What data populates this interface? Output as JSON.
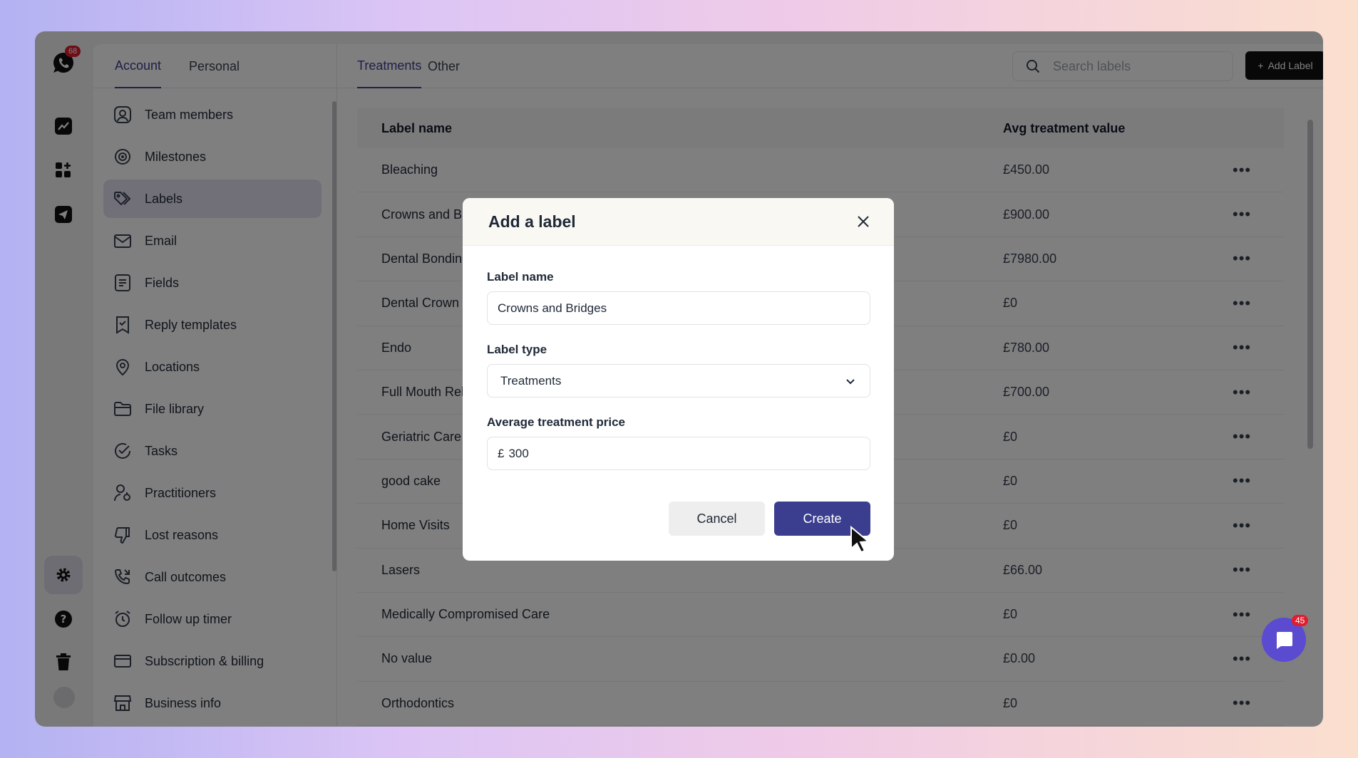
{
  "rail": {
    "logo_badge": "68",
    "icons": [
      "chart-icon",
      "dashboard-icon",
      "send-icon"
    ],
    "bottom_icons": [
      "settings-icon",
      "help-icon",
      "trash-icon",
      "avatar"
    ]
  },
  "settings": {
    "tabs": [
      {
        "label": "Account",
        "active": true
      },
      {
        "label": "Personal",
        "active": false
      }
    ],
    "menu": [
      {
        "label": "Team members",
        "icon": "user-square-icon"
      },
      {
        "label": "Milestones",
        "icon": "target-icon"
      },
      {
        "label": "Labels",
        "icon": "tags-icon",
        "active": true
      },
      {
        "label": "Email",
        "icon": "mail-icon"
      },
      {
        "label": "Fields",
        "icon": "form-icon"
      },
      {
        "label": "Reply templates",
        "icon": "bookmark-icon"
      },
      {
        "label": "Locations",
        "icon": "pin-icon"
      },
      {
        "label": "File library",
        "icon": "folder-icon"
      },
      {
        "label": "Tasks",
        "icon": "check-circle-icon"
      },
      {
        "label": "Practitioners",
        "icon": "practitioner-icon"
      },
      {
        "label": "Lost reasons",
        "icon": "thumbs-down-icon"
      },
      {
        "label": "Call outcomes",
        "icon": "phone-icon"
      },
      {
        "label": "Follow up timer",
        "icon": "alarm-icon"
      },
      {
        "label": "Subscription & billing",
        "icon": "card-icon"
      },
      {
        "label": "Business info",
        "icon": "store-icon"
      }
    ]
  },
  "main": {
    "tabs": [
      {
        "label": "Treatments",
        "active": true
      },
      {
        "label": "Other",
        "active": false
      }
    ],
    "search_placeholder": "Search labels",
    "add_label": "Add Label",
    "columns": [
      "Label name",
      "Avg treatment value"
    ],
    "rows": [
      {
        "name": "Bleaching",
        "value": "£450.00"
      },
      {
        "name": "Crowns and Bridges",
        "value": "£900.00"
      },
      {
        "name": "Dental Bonding",
        "value": "£7980.00"
      },
      {
        "name": "Dental Crown",
        "value": "£0"
      },
      {
        "name": "Endo",
        "value": "£780.00"
      },
      {
        "name": "Full Mouth Rehab",
        "value": "£700.00"
      },
      {
        "name": "Geriatric Care",
        "value": "£0"
      },
      {
        "name": "good cake",
        "value": "£0"
      },
      {
        "name": "Home Visits",
        "value": "£0"
      },
      {
        "name": "Lasers",
        "value": "£66.00"
      },
      {
        "name": "Medically Compromised Care",
        "value": "£0"
      },
      {
        "name": "No value",
        "value": "£0.00"
      },
      {
        "name": "Orthodontics",
        "value": "£0"
      }
    ]
  },
  "modal": {
    "title": "Add a label",
    "name_label": "Label name",
    "name_value": "Crowns and Bridges",
    "type_label": "Label type",
    "type_value": "Treatments",
    "price_label": "Average treatment price",
    "currency": "£",
    "price_value": "300",
    "cancel": "Cancel",
    "create": "Create"
  },
  "chat_badge": "45",
  "colors": {
    "accent": "#3b3d8e",
    "badge": "#e11d2e",
    "chat": "#5b4bd1"
  }
}
